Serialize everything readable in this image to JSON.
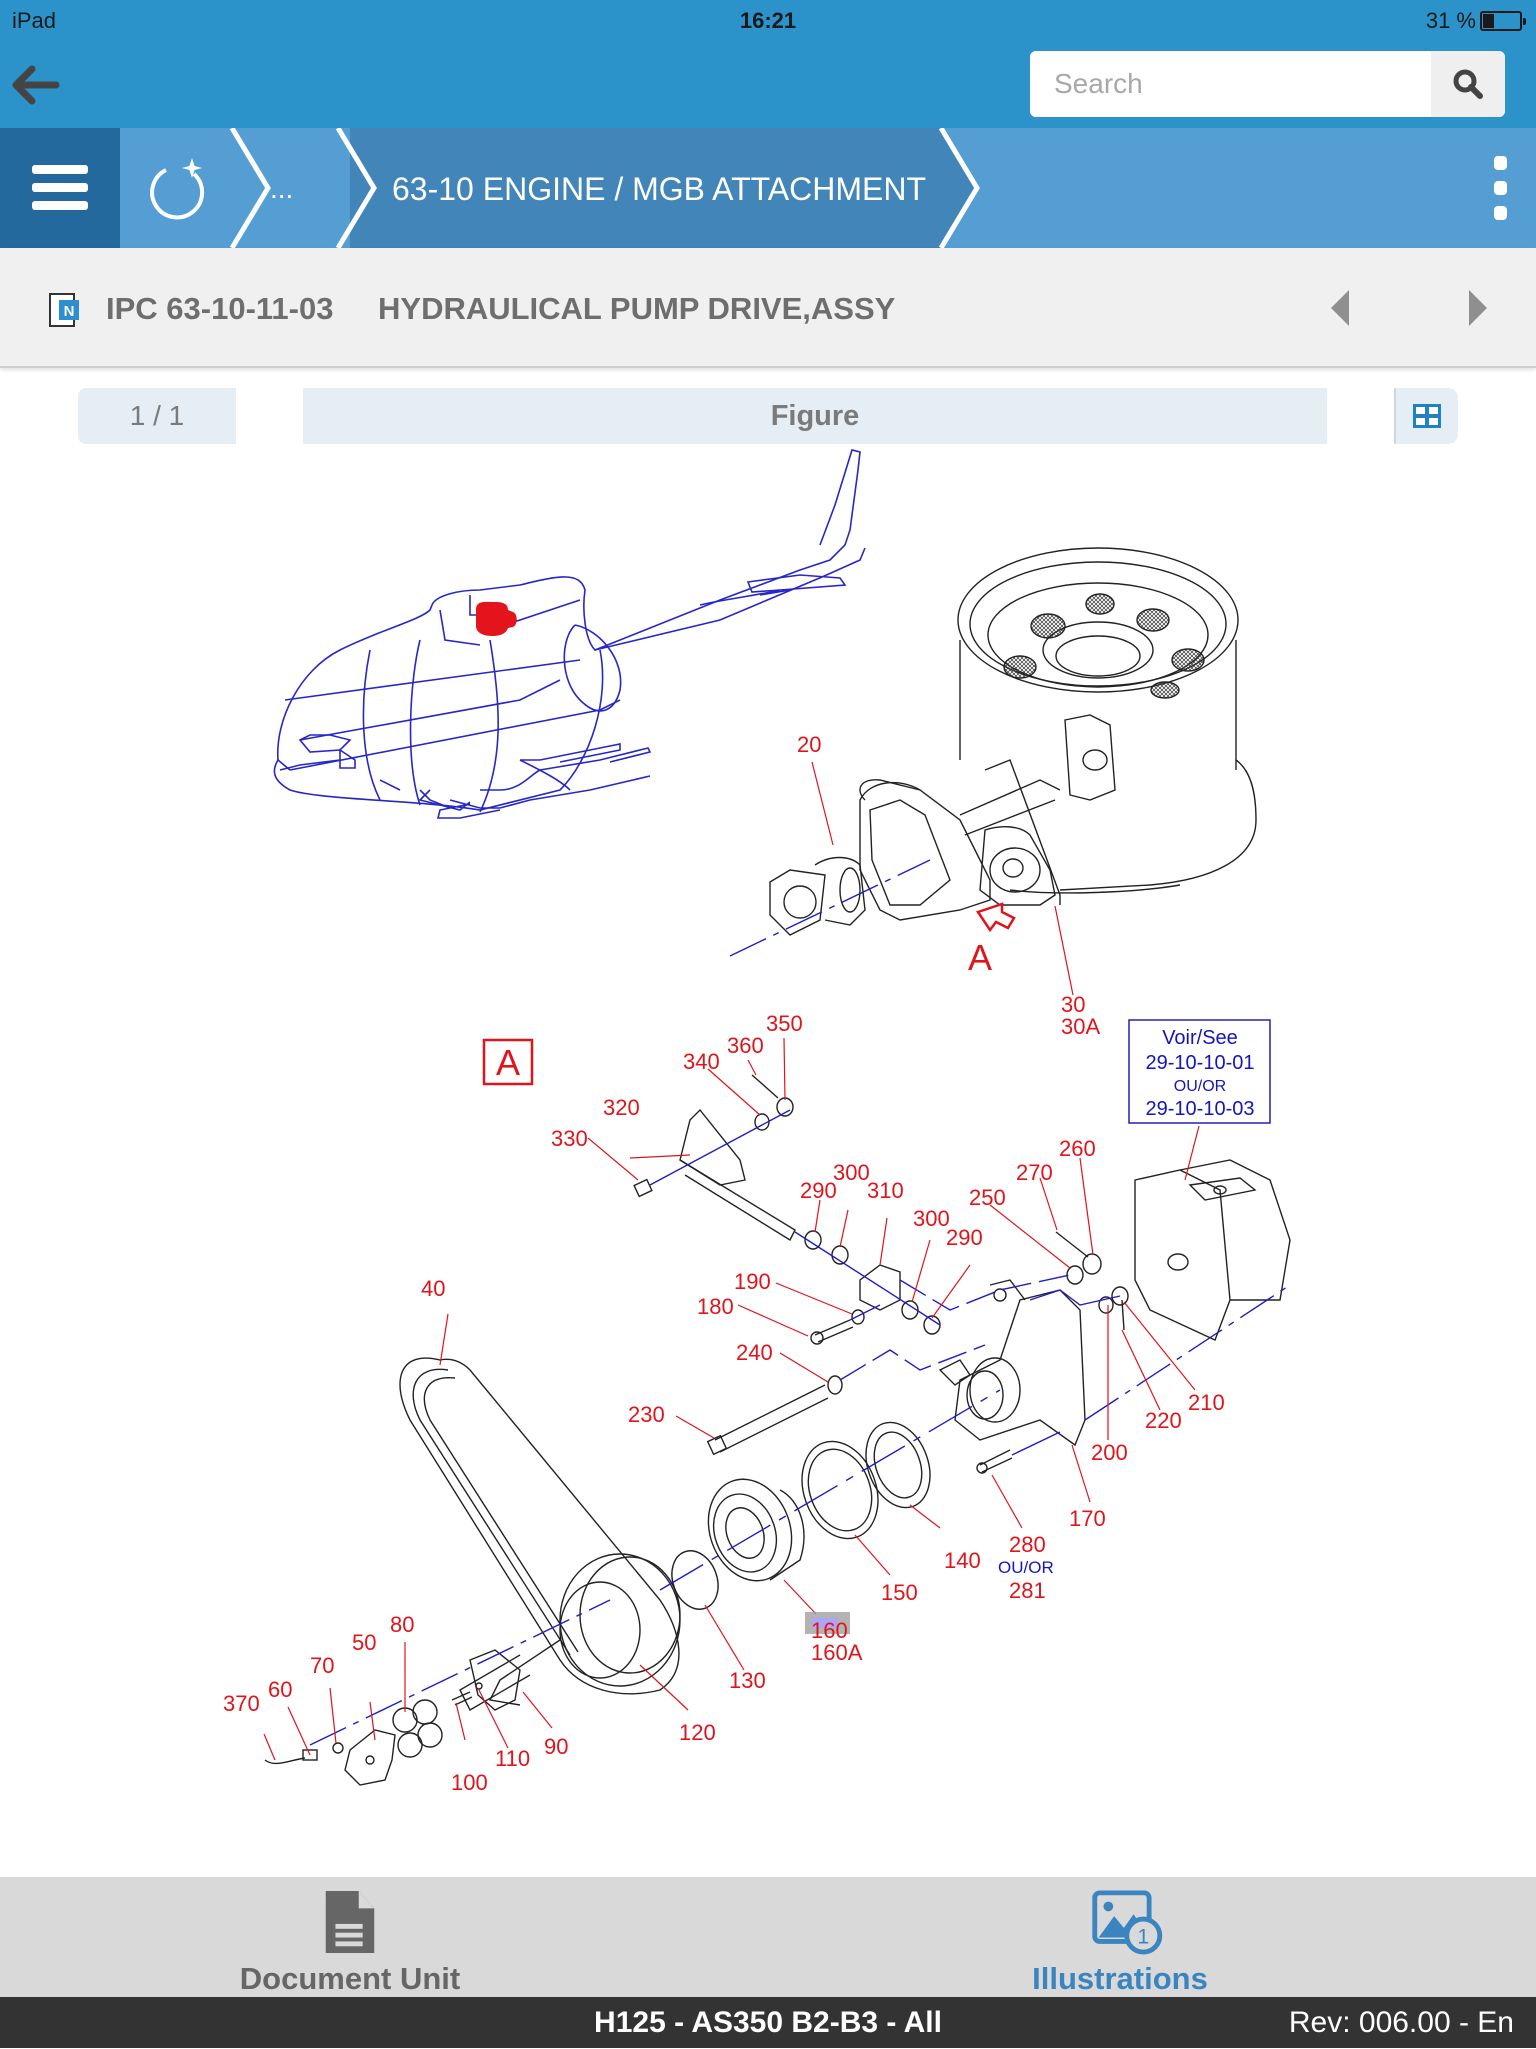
{
  "status_bar": {
    "device": "iPad",
    "time": "16:21",
    "battery_text": "31 %",
    "battery_level": 0.31
  },
  "header": {
    "back_icon": "arrow-left-icon",
    "search": {
      "placeholder": "Search",
      "value": "",
      "icon": "search-icon"
    }
  },
  "navbar": {
    "menu_icon": "hamburger-icon",
    "home_icon": "refresh-home-icon",
    "breadcrumb": {
      "ellipsis": "...",
      "current": "63-10 ENGINE / MGB ATTACHMENT"
    },
    "more_icon": "kebab-icon"
  },
  "document": {
    "icon": "document-n-icon",
    "code": "IPC 63-10-11-03",
    "title": "HYDRAULICAL PUMP DRIVE,ASSY",
    "prev_icon": "triangle-left-icon",
    "next_icon": "triangle-right-icon"
  },
  "figure_toolbar": {
    "pager": "1 / 1",
    "tab_label": "Figure",
    "grid_icon": "grid-icon"
  },
  "figure": {
    "view_letter": "A",
    "view_box_letter": "A",
    "reference_box": {
      "line1": "Voir/See",
      "line2": "29-10-10-01",
      "line3": "OU/OR",
      "line4": "29-10-10-03"
    },
    "callouts": [
      {
        "id": "c20",
        "text": "20"
      },
      {
        "id": "c30",
        "text": "30"
      },
      {
        "id": "c30a",
        "text": "30A"
      },
      {
        "id": "c40",
        "text": "40"
      },
      {
        "id": "c50",
        "text": "50"
      },
      {
        "id": "c60",
        "text": "60"
      },
      {
        "id": "c70",
        "text": "70"
      },
      {
        "id": "c80",
        "text": "80"
      },
      {
        "id": "c90",
        "text": "90"
      },
      {
        "id": "c100",
        "text": "100"
      },
      {
        "id": "c110",
        "text": "110"
      },
      {
        "id": "c120",
        "text": "120"
      },
      {
        "id": "c130",
        "text": "130"
      },
      {
        "id": "c140",
        "text": "140"
      },
      {
        "id": "c150",
        "text": "150"
      },
      {
        "id": "c160",
        "text": "160"
      },
      {
        "id": "c160a",
        "text": "160A"
      },
      {
        "id": "c170",
        "text": "170"
      },
      {
        "id": "c180",
        "text": "180"
      },
      {
        "id": "c190",
        "text": "190"
      },
      {
        "id": "c200",
        "text": "200"
      },
      {
        "id": "c210",
        "text": "210"
      },
      {
        "id": "c220",
        "text": "220"
      },
      {
        "id": "c230",
        "text": "230"
      },
      {
        "id": "c240",
        "text": "240"
      },
      {
        "id": "c250",
        "text": "250"
      },
      {
        "id": "c260",
        "text": "260"
      },
      {
        "id": "c270",
        "text": "270"
      },
      {
        "id": "c280",
        "text": "280"
      },
      {
        "id": "c280or",
        "text": "OU/OR"
      },
      {
        "id": "c281",
        "text": "281"
      },
      {
        "id": "c290a",
        "text": "290"
      },
      {
        "id": "c290b",
        "text": "290"
      },
      {
        "id": "c300a",
        "text": "300"
      },
      {
        "id": "c300b",
        "text": "300"
      },
      {
        "id": "c310",
        "text": "310"
      },
      {
        "id": "c320",
        "text": "320"
      },
      {
        "id": "c330",
        "text": "330"
      },
      {
        "id": "c340",
        "text": "340"
      },
      {
        "id": "c350",
        "text": "350"
      },
      {
        "id": "c360",
        "text": "360"
      },
      {
        "id": "c370",
        "text": "370"
      }
    ],
    "highlighted_callout": "160",
    "colors": {
      "callout": "#e0141b",
      "axis": "#1d1dc8",
      "helicopter": "#2727c8",
      "highlight": "#e3141b"
    }
  },
  "tabbar": {
    "tabs": [
      {
        "label": "Document Unit",
        "icon": "document-icon",
        "active": false
      },
      {
        "label": "Illustrations",
        "icon": "image-icon",
        "badge": "1",
        "active": true
      }
    ]
  },
  "footer": {
    "model": "H125 - AS350 B2-B3 - All",
    "revision": "Rev: 006.00 - En"
  },
  "colors": {
    "top_bar": "#2b93ca",
    "nav_bar": "#559ed4",
    "nav_active": "#4285b8",
    "menu_bg": "#24699d",
    "active_tab": "#3a84c0",
    "inactive_tab": "#666666"
  }
}
